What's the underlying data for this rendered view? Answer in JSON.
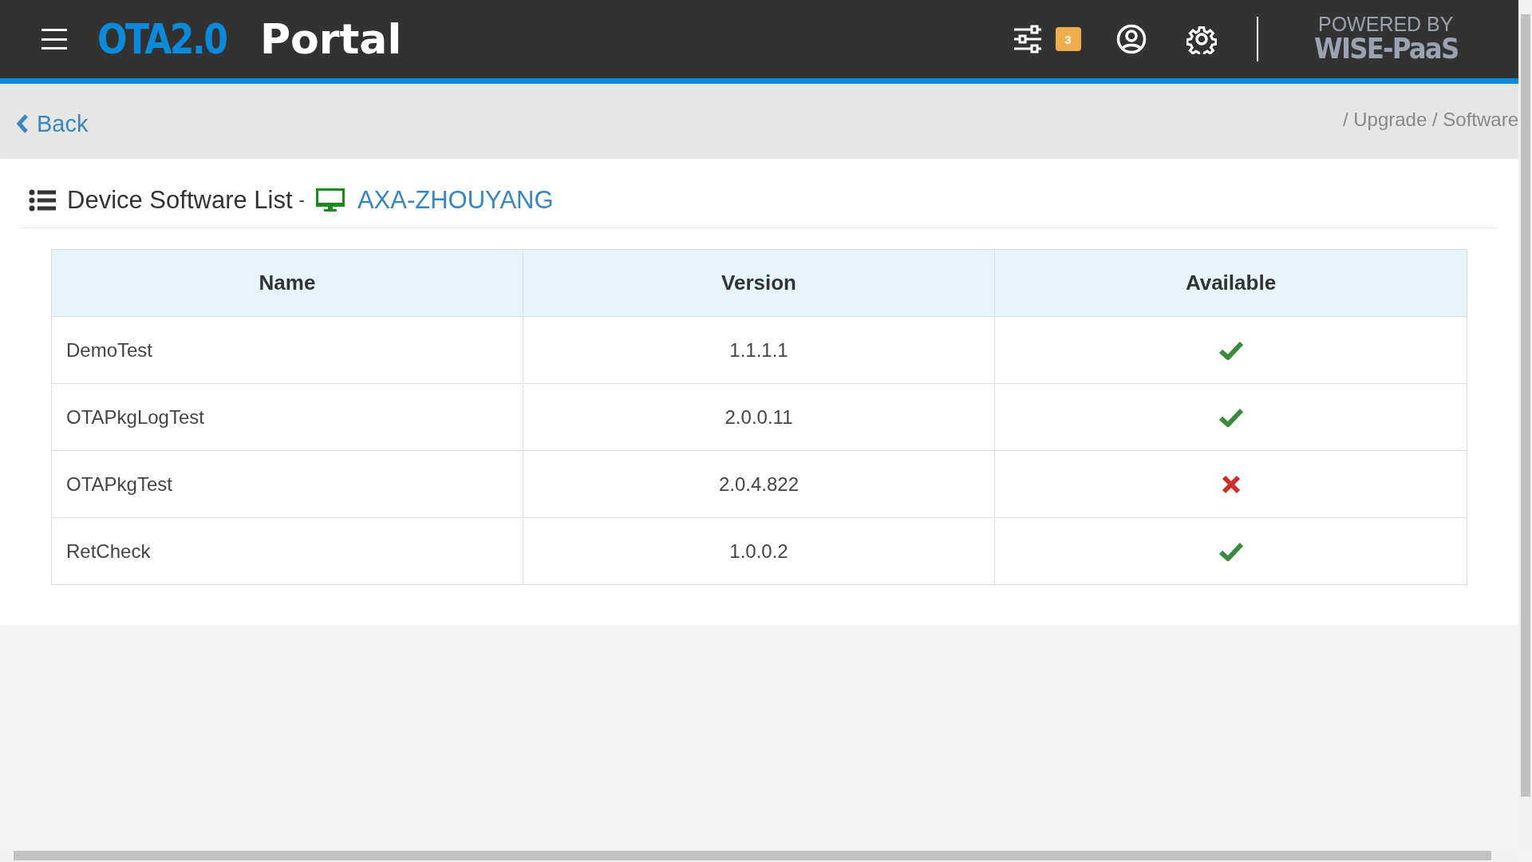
{
  "header": {
    "logo_accent": "OTA2.0",
    "logo_text": "Portal",
    "notification_count": "3",
    "powered_by": "POWERED BY",
    "brand": "WISE-PaaS"
  },
  "nav": {
    "back": "Back",
    "breadcrumb": "/ Upgrade / Software"
  },
  "panel": {
    "title": "Device Software List",
    "separator": "-",
    "device": "AXA-ZHOUYANG"
  },
  "table": {
    "columns": [
      "Name",
      "Version",
      "Available"
    ],
    "rows": [
      {
        "name": "DemoTest",
        "version": "1.1.1.1",
        "available": true
      },
      {
        "name": "OTAPkgLogTest",
        "version": "2.0.0.11",
        "available": true
      },
      {
        "name": "OTAPkgTest",
        "version": "2.0.4.822",
        "available": false
      },
      {
        "name": "RetCheck",
        "version": "1.0.0.2",
        "available": true
      }
    ]
  }
}
